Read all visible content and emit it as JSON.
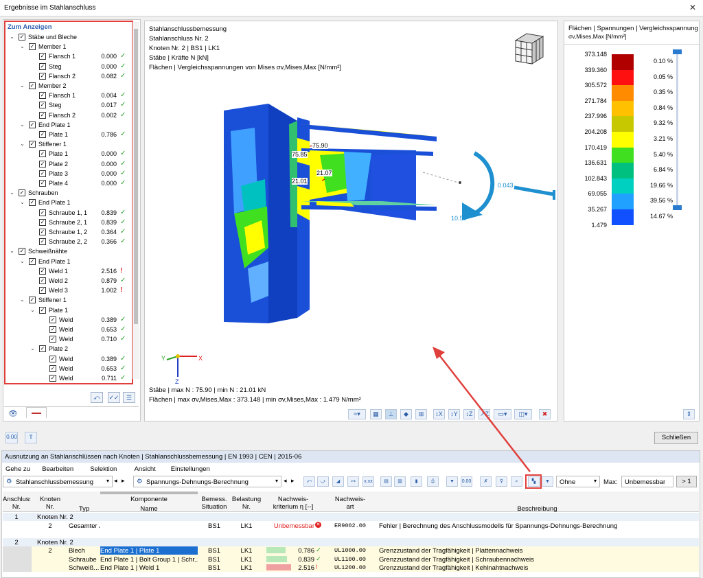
{
  "window": {
    "title": "Ergebnisse im Stahlanschluss",
    "close": "✕"
  },
  "tree": {
    "header": "Zum Anzeigen",
    "rows": [
      {
        "level": 0,
        "label": "Stäbe und Bleche",
        "value": "",
        "status": ""
      },
      {
        "level": 1,
        "label": "Member 1",
        "value": "",
        "status": ""
      },
      {
        "level": 2,
        "label": "Flansch 1",
        "value": "0.000",
        "status": "ok"
      },
      {
        "level": 2,
        "label": "Steg",
        "value": "0.000",
        "status": "ok"
      },
      {
        "level": 2,
        "label": "Flansch 2",
        "value": "0.082",
        "status": "ok"
      },
      {
        "level": 1,
        "label": "Member 2",
        "value": "",
        "status": ""
      },
      {
        "level": 2,
        "label": "Flansch 1",
        "value": "0.004",
        "status": "ok"
      },
      {
        "level": 2,
        "label": "Steg",
        "value": "0.017",
        "status": "ok"
      },
      {
        "level": 2,
        "label": "Flansch 2",
        "value": "0.002",
        "status": "ok"
      },
      {
        "level": 1,
        "label": "End Plate 1",
        "value": "",
        "status": ""
      },
      {
        "level": 2,
        "label": "Plate 1",
        "value": "0.786",
        "status": "ok"
      },
      {
        "level": 1,
        "label": "Stiffener 1",
        "value": "",
        "status": ""
      },
      {
        "level": 2,
        "label": "Plate 1",
        "value": "0.000",
        "status": "ok"
      },
      {
        "level": 2,
        "label": "Plate 2",
        "value": "0.000",
        "status": "ok"
      },
      {
        "level": 2,
        "label": "Plate 3",
        "value": "0.000",
        "status": "ok"
      },
      {
        "level": 2,
        "label": "Plate 4",
        "value": "0.000",
        "status": "ok"
      },
      {
        "level": 0,
        "label": "Schrauben",
        "value": "",
        "status": ""
      },
      {
        "level": 1,
        "label": "End Plate 1",
        "value": "",
        "status": ""
      },
      {
        "level": 2,
        "label": "Schraube 1, 1",
        "value": "0.839",
        "status": "ok"
      },
      {
        "level": 2,
        "label": "Schraube 2, 1",
        "value": "0.839",
        "status": "ok"
      },
      {
        "level": 2,
        "label": "Schraube 1, 2",
        "value": "0.364",
        "status": "ok"
      },
      {
        "level": 2,
        "label": "Schraube 2, 2",
        "value": "0.366",
        "status": "ok"
      },
      {
        "level": 0,
        "label": "Schweißnähte",
        "value": "",
        "status": ""
      },
      {
        "level": 1,
        "label": "End Plate 1",
        "value": "",
        "status": ""
      },
      {
        "level": 2,
        "label": "Weld 1",
        "value": "2.516",
        "status": "bad"
      },
      {
        "level": 2,
        "label": "Weld 2",
        "value": "0.879",
        "status": "ok"
      },
      {
        "level": 2,
        "label": "Weld 3",
        "value": "1.002",
        "status": "bad"
      },
      {
        "level": 1,
        "label": "Stiffener 1",
        "value": "",
        "status": ""
      },
      {
        "level": 2,
        "label": "Plate 1",
        "value": "",
        "status": ""
      },
      {
        "level": 3,
        "label": "Weld",
        "value": "0.389",
        "status": "ok"
      },
      {
        "level": 3,
        "label": "Weld",
        "value": "0.653",
        "status": "ok"
      },
      {
        "level": 3,
        "label": "Weld",
        "value": "0.710",
        "status": "ok"
      },
      {
        "level": 2,
        "label": "Plate 2",
        "value": "",
        "status": ""
      },
      {
        "level": 3,
        "label": "Weld",
        "value": "0.389",
        "status": "ok"
      },
      {
        "level": 3,
        "label": "Weld",
        "value": "0.653",
        "status": "ok"
      },
      {
        "level": 3,
        "label": "Weld",
        "value": "0.711",
        "status": "ok"
      }
    ]
  },
  "view": {
    "line1": "Stahlanschlussbemessung",
    "line2": "Stahlanschluss Nr. 2",
    "line3": "Knoten Nr. 2 | BS1 | LK1",
    "line4": "Stäbe | Kräfte N [kN]",
    "line5": "Flächen | Vergleichsspannungen von Mises σv,Mises,Max [N/mm²]",
    "foot1": "Stäbe | max N : 75.90 | min N : 21.01 kN",
    "foot2": "Flächen | max σv,Mises,Max : 373.148 | min σv,Mises,Max : 1.479 N/mm²",
    "labels": {
      "l1": "75.90",
      "l2": "75.85",
      "l3": "21.07",
      "l4": "21.01",
      "moment1": "10.50",
      "moment2": "0.043"
    },
    "axes": {
      "x": "X",
      "y": "Y",
      "z": "Z"
    }
  },
  "legend": {
    "title": "Flächen | Spannungen | Vergleichsspannung",
    "subtitle": "σv,Mises,Max [N/mm²]",
    "values": [
      "373.148",
      "339.360",
      "305.572",
      "271.784",
      "237.996",
      "204.208",
      "170.419",
      "136.631",
      "102.843",
      "69.055",
      "35.267",
      "1.479"
    ],
    "colors": [
      "#b00000",
      "#ff1010",
      "#ff8c00",
      "#ffc000",
      "#c8c800",
      "#ffff00",
      "#40e020",
      "#00c080",
      "#00d0c0",
      "#20a0ff",
      "#1050ff",
      "#0000c0",
      "#000090"
    ],
    "percents": [
      "0.10 %",
      "0.05 %",
      "0.35 %",
      "0.84 %",
      "9.32 %",
      "3.21 %",
      "5.40 %",
      "6.84 %",
      "19.66 %",
      "39.56 %",
      "14.67 %"
    ]
  },
  "actions": {
    "close": "Schließen"
  },
  "results": {
    "title": "Ausnutzung an Stahlanschlüssen nach Knoten | Stahlanschlussbemessung | EN 1993 | CEN | 2015-06",
    "menu": [
      "Gehe zu",
      "Bearbeiten",
      "Selektion",
      "Ansicht",
      "Einstellungen"
    ],
    "combo1": "Stahlanschlussbemessung",
    "combo2": "Spannungs-Dehnungs-Berechnung",
    "filter": "Ohne",
    "max_label": "Max:",
    "max_value": "Unbemessbar",
    "gt": "> 1",
    "columns": {
      "c1": "Anschluss\nNr.",
      "c2": "Knoten\nNr.",
      "c3": "Typ",
      "c4top": "Komponente",
      "c4": "Name",
      "c5": "Bemess.\nSituation",
      "c6": "Belastung\nNr.",
      "c7": "Nachweis-\nkriterium η [--]",
      "c8": "Nachweis-\nart",
      "c9": "Beschreibung"
    },
    "groups": [
      {
        "anschluss": "1",
        "title": "Knoten Nr. 2",
        "rows": [
          {
            "knoten": "2",
            "typ": "Gesamter Anschluss",
            "name": "",
            "sit": "BS1",
            "last": "LK1",
            "eta": "Unbemessbar",
            "eta_bar": 0,
            "status": "err",
            "art": "ER9002.00",
            "desc": "Fehler | Berechnung des Anschlussmodells für Spannungs-Dehnungs-Berechnung"
          }
        ]
      },
      {
        "anschluss": "2",
        "title": "Knoten Nr. 2",
        "rows": [
          {
            "knoten": "2",
            "typ": "Blech",
            "name": "End Plate 1 | Plate 1",
            "sit": "BS1",
            "last": "LK1",
            "eta": "0.786",
            "eta_bar": 0.786,
            "status": "ok",
            "art": "UL1000.00",
            "desc": "Grenzzustand der Tragfähigkeit | Plattennachweis"
          },
          {
            "knoten": "",
            "typ": "Schraube",
            "name": "End Plate 1 | Bolt Group 1 | Schr...",
            "sit": "BS1",
            "last": "LK1",
            "eta": "0.839",
            "eta_bar": 0.839,
            "status": "ok",
            "art": "UL1100.00",
            "desc": "Grenzzustand der Tragfähigkeit | Schraubennachweis"
          },
          {
            "knoten": "",
            "typ": "Schweiß...",
            "name": "End Plate 1 | Weld 1",
            "sit": "BS1",
            "last": "LK1",
            "eta": "2.516",
            "eta_bar": 1,
            "status": "bad",
            "art": "UL1200.00",
            "desc": "Grenzzustand der Tragfähigkeit | Kehlnahtnachweis"
          }
        ]
      }
    ]
  }
}
